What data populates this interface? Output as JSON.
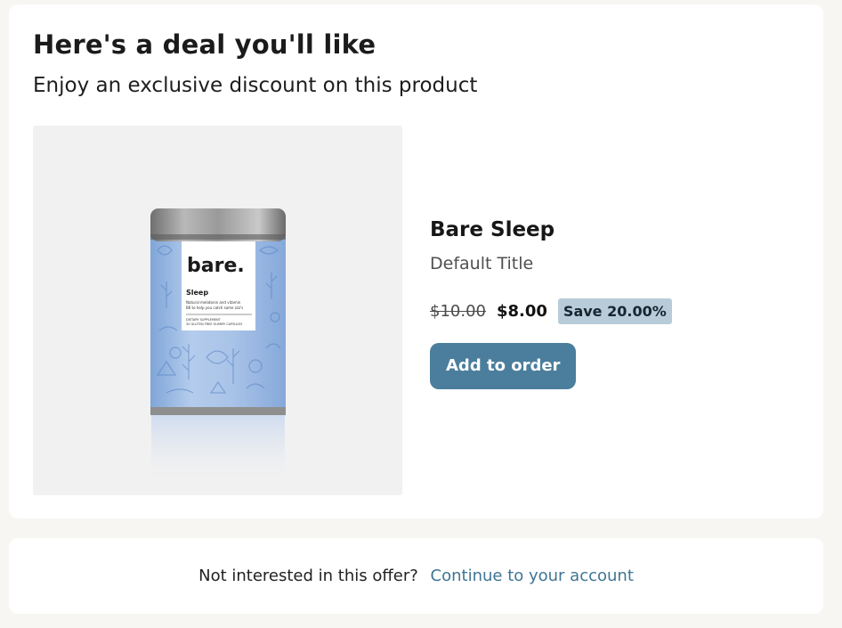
{
  "offer": {
    "title": "Here's a deal you'll like",
    "subtitle": "Enjoy an exclusive discount on this product"
  },
  "product": {
    "name": "Bare Sleep",
    "variant": "Default Title",
    "compare_price": "$10.00",
    "price": "$8.00",
    "badge": "Save 20.00%",
    "add_button": "Add to order",
    "image": {
      "brand": "bare.",
      "label": "Sleep",
      "desc_line1": "Natural melatonin and vitamin",
      "desc_line2": "B6 to help you catch some zzz's",
      "small_line1": "DIETARY SUPPLEMENT",
      "small_line2": "30 GLUTEN FREE GUMMY CAPSULES"
    }
  },
  "footer": {
    "prompt": "Not interested in this offer?",
    "link": "Continue to your account"
  },
  "colors": {
    "accent": "#4b7e9c",
    "badge_bg": "#b7cbd8",
    "link": "#3f7594",
    "page_bg": "#f7f6f3"
  }
}
